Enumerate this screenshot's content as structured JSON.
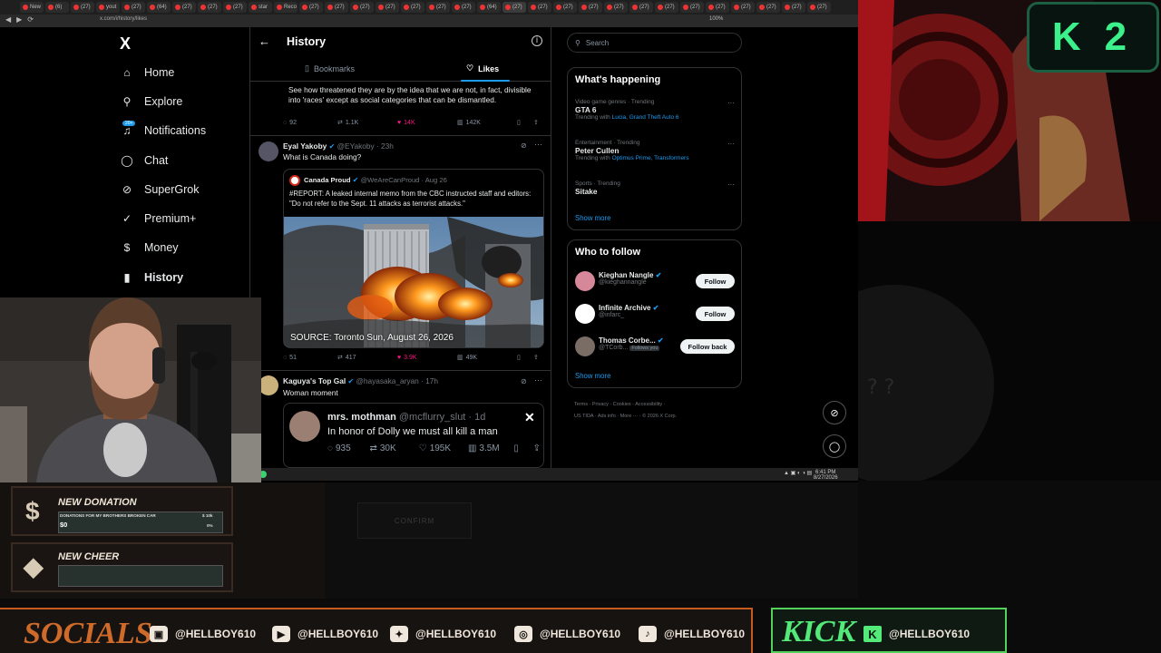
{
  "browser": {
    "tabs": [
      "New",
      "(6)",
      "(27)",
      "yout",
      "(27)",
      "(64)",
      "(27)",
      "(27)",
      "(27)",
      "star",
      "Reco",
      "(27)",
      "(27)",
      "(27)",
      "(27)",
      "(27)",
      "(27)",
      "(27)",
      "(64)",
      "(27)",
      "(27)",
      "(27)",
      "(27)",
      "(27)",
      "(27)",
      "(27)",
      "(27)",
      "(27)",
      "(27)",
      "(27)",
      "(27)",
      "(27)"
    ],
    "url": "x.com/i/history/likes",
    "zoom": "100%"
  },
  "nav": {
    "logo": "X",
    "badge": "20+",
    "items": [
      {
        "label": "Home",
        "icon": "home-icon",
        "glyph": "⌂"
      },
      {
        "label": "Explore",
        "icon": "search-icon",
        "glyph": "⚲"
      },
      {
        "label": "Notifications",
        "icon": "bell-icon",
        "glyph": "♫"
      },
      {
        "label": "Chat",
        "icon": "chat-icon",
        "glyph": "◯"
      },
      {
        "label": "SuperGrok",
        "icon": "grok-icon",
        "glyph": "⊘"
      },
      {
        "label": "Premium+",
        "icon": "verified-icon",
        "glyph": "✓"
      },
      {
        "label": "Money",
        "icon": "money-icon",
        "glyph": "$"
      },
      {
        "label": "History",
        "icon": "bookmark-icon",
        "glyph": "▮"
      }
    ]
  },
  "header": {
    "title": "History",
    "tabs": {
      "bookmarks": "Bookmarks",
      "likes": "Likes"
    }
  },
  "posts": {
    "p1": {
      "text": "See how threatened they are by the idea that we are not, in fact, divisible into 'races' except as social categories that can be dismantled.",
      "replies": "92",
      "reposts": "1.1K",
      "likes": "14K",
      "views": "142K"
    },
    "p2": {
      "name": "Eyal Yakoby",
      "handle": "@EYakoby · 23h",
      "text": "What is Canada doing?",
      "quote": {
        "name": "Canada Proud",
        "handle": "@WeAreCanProud · Aug 26",
        "text": "#REPORT: A leaked internal memo from the CBC instructed staff and editors: \"Do not refer to the Sept. 11 attacks as terrorist attacks.\"",
        "caption": "SOURCE: Toronto Sun, August 26, 2026"
      },
      "replies": "51",
      "reposts": "417",
      "likes": "3.9K",
      "views": "49K"
    },
    "p3": {
      "name": "Kaguya's Top Gal",
      "handle": "@hayasaka_aryan · 17h",
      "text": "Woman moment",
      "embed": {
        "name": "mrs. mothman",
        "handle": "@mcflurry_slut · 1d",
        "text": "In honor of Dolly we must all kill a man",
        "replies": "935",
        "reposts": "30K",
        "likes": "195K",
        "views": "3.5M"
      }
    }
  },
  "right": {
    "search_placeholder": "Search",
    "whats_happening": "What's happening",
    "trends": [
      {
        "meta": "Video game genres · Trending",
        "name": "GTA 6",
        "sub_prefix": "Trending with ",
        "sub_links": "Lucia, Grand Theft Auto 6"
      },
      {
        "meta": "Entertainment · Trending",
        "name": "Peter Cullen",
        "sub_prefix": "Trending with ",
        "sub_links": "Optimus Prime, Transformers"
      },
      {
        "meta": "Sports · Trending",
        "name": "Sitake",
        "sub_prefix": "",
        "sub_links": ""
      }
    ],
    "show_more": "Show more",
    "who_to_follow": "Who to follow",
    "follow": [
      {
        "name": "Kieghan Nangle",
        "handle": "@kieghannangle",
        "button": "Follow",
        "follows_you": ""
      },
      {
        "name": "Infinite Archive",
        "handle": "@infarc_",
        "button": "Follow",
        "follows_you": ""
      },
      {
        "name": "Thomas Corbe...",
        "handle": "@TCorb...",
        "button": "Follow back",
        "follows_you": "Follows you"
      }
    ],
    "footer": {
      "line1": "Terms  ·  Privacy  ·  Cookies  ·  Accessibility  ·",
      "line2": "US TIDA  ·  Ads info  ·  More ···  ·  © 2026 X Corp."
    }
  },
  "taskbar": {
    "time": "6:41 PM",
    "date": "8/27/2026"
  },
  "overlay": {
    "k2": "K2",
    "donation": {
      "title": "NEW DONATION",
      "goal": "DONATIONS FOR MY BROTHERS BROKEN CAR",
      "goal_right": "$ 10k",
      "amount": "$0",
      "pct": "0%"
    },
    "cheer": {
      "title": "NEW CHEER"
    },
    "confirm": "CONFIRM",
    "socials_title": "SOCIALS",
    "socials": [
      {
        "platform": "twitch-icon",
        "handle": "@HELLBOY610",
        "glyph": "▣"
      },
      {
        "platform": "youtube-icon",
        "handle": "@HELLBOY610",
        "glyph": "▶"
      },
      {
        "platform": "twitter-icon",
        "handle": "@HELLBOY610",
        "glyph": "✦"
      },
      {
        "platform": "instagram-icon",
        "handle": "@HELLBOY610",
        "glyph": "◎"
      },
      {
        "platform": "tiktok-icon",
        "handle": "@HELLBOY610",
        "glyph": "♪"
      }
    ],
    "kick_title": "KICK",
    "kick_handle": "@HELLBOY610",
    "kick_letter": "K"
  }
}
